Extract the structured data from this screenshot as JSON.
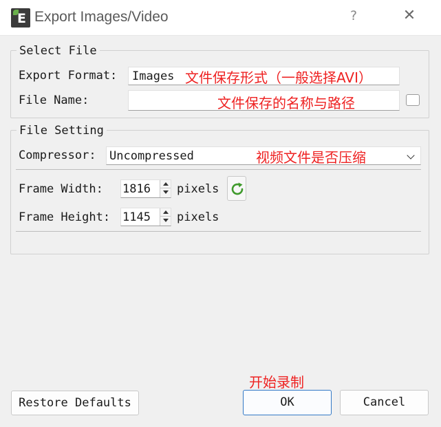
{
  "window": {
    "title": "Export Images/Video",
    "help_label": "?",
    "close_label": "✕",
    "icon_letter": "E"
  },
  "select_file": {
    "group_title": "Select File",
    "export_format_label": "Export Format:",
    "export_format_value": "Images",
    "export_format_note": "文件保存形式（一般选择AVI）",
    "file_name_label": "File Name:",
    "file_name_value": "",
    "file_name_note": "文件保存的名称与路径"
  },
  "file_setting": {
    "group_title": "File Setting",
    "compressor_label": "Compressor:",
    "compressor_value": "Uncompressed",
    "compressor_note": "视频文件是否压缩",
    "frame_width_label": "Frame Width:",
    "frame_width_value": "1816",
    "frame_height_label": "Frame Height:",
    "frame_height_value": "1145",
    "unit_label": "pixels"
  },
  "footer": {
    "restore_label": "Restore Defaults",
    "ok_label": "OK",
    "ok_note": "开始录制",
    "cancel_label": "Cancel"
  },
  "colors": {
    "annotation": "#ee2222",
    "accent": "#3178c6",
    "refresh_icon": "#3f9a2c"
  },
  "icons": {
    "refresh": "refresh-icon",
    "checkbox": "checkbox-unchecked"
  }
}
